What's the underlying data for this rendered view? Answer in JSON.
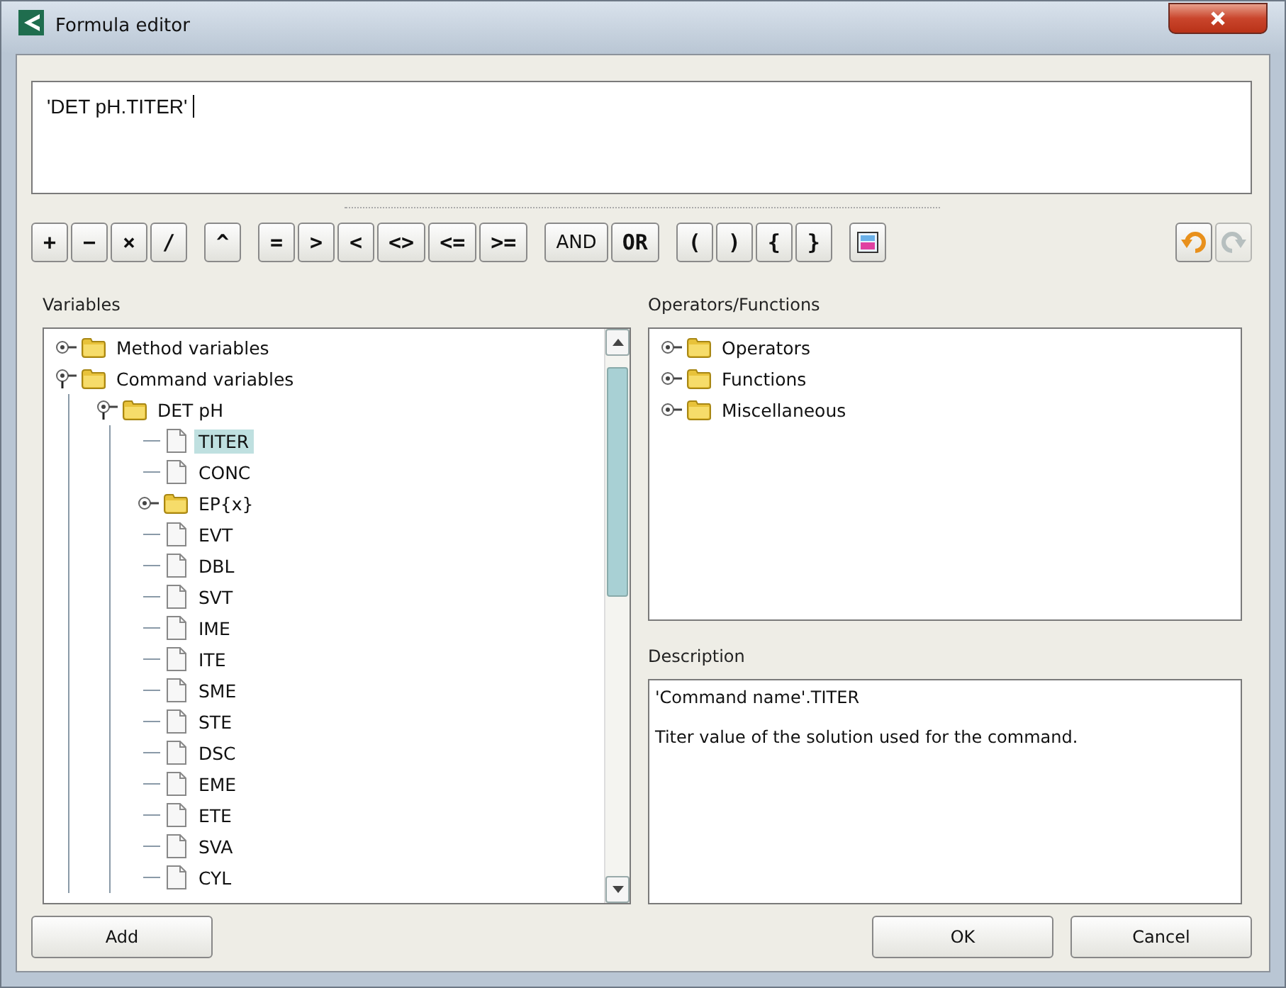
{
  "window": {
    "title": "Formula editor"
  },
  "formula": {
    "value": "'DET pH.TITER'"
  },
  "toolbar": {
    "groups": [
      [
        "+",
        "−",
        "×",
        "/"
      ],
      [
        "^"
      ],
      [
        "=",
        ">",
        "<",
        "<>",
        "<=",
        ">="
      ],
      [
        "AND",
        "OR"
      ],
      [
        "(",
        ")",
        "{",
        "}"
      ]
    ],
    "tools": [
      {
        "kind": "color",
        "disabled": false
      },
      {
        "kind": "undo",
        "disabled": false
      },
      {
        "kind": "redo",
        "disabled": true
      }
    ]
  },
  "variables": {
    "label": "Variables",
    "items": [
      {
        "label": "Method variables",
        "kind": "folder",
        "expanded": false,
        "selected": false
      },
      {
        "label": "Command variables",
        "kind": "folder",
        "expanded": true,
        "selected": false,
        "children": [
          {
            "label": "DET pH",
            "kind": "folder",
            "expanded": true,
            "selected": false,
            "children": [
              {
                "label": "TITER",
                "kind": "document",
                "selected": true
              },
              {
                "label": "CONC",
                "kind": "document",
                "selected": false
              },
              {
                "label": "EP{x}",
                "kind": "folder",
                "expanded": false,
                "selected": false
              },
              {
                "label": "EVT",
                "kind": "document",
                "selected": false
              },
              {
                "label": "DBL",
                "kind": "document",
                "selected": false
              },
              {
                "label": "SVT",
                "kind": "document",
                "selected": false
              },
              {
                "label": "IME",
                "kind": "document",
                "selected": false
              },
              {
                "label": "ITE",
                "kind": "document",
                "selected": false
              },
              {
                "label": "SME",
                "kind": "document",
                "selected": false
              },
              {
                "label": "STE",
                "kind": "document",
                "selected": false
              },
              {
                "label": "DSC",
                "kind": "document",
                "selected": false
              },
              {
                "label": "EME",
                "kind": "document",
                "selected": false
              },
              {
                "label": "ETE",
                "kind": "document",
                "selected": false
              },
              {
                "label": "SVA",
                "kind": "document",
                "selected": false
              },
              {
                "label": "CYL",
                "kind": "document",
                "selected": false
              }
            ]
          }
        ]
      }
    ]
  },
  "operators": {
    "label": "Operators/Functions",
    "items": [
      {
        "label": "Operators",
        "kind": "folder",
        "expanded": false,
        "selected": false
      },
      {
        "label": "Functions",
        "kind": "folder",
        "expanded": false,
        "selected": false
      },
      {
        "label": "Miscellaneous",
        "kind": "folder",
        "expanded": false,
        "selected": false
      }
    ]
  },
  "description": {
    "label": "Description",
    "lines": [
      "'Command name'.TITER",
      "Titer value of the solution used for the command."
    ]
  },
  "buttons": {
    "add": "Add",
    "ok": "OK",
    "cancel": "Cancel"
  }
}
